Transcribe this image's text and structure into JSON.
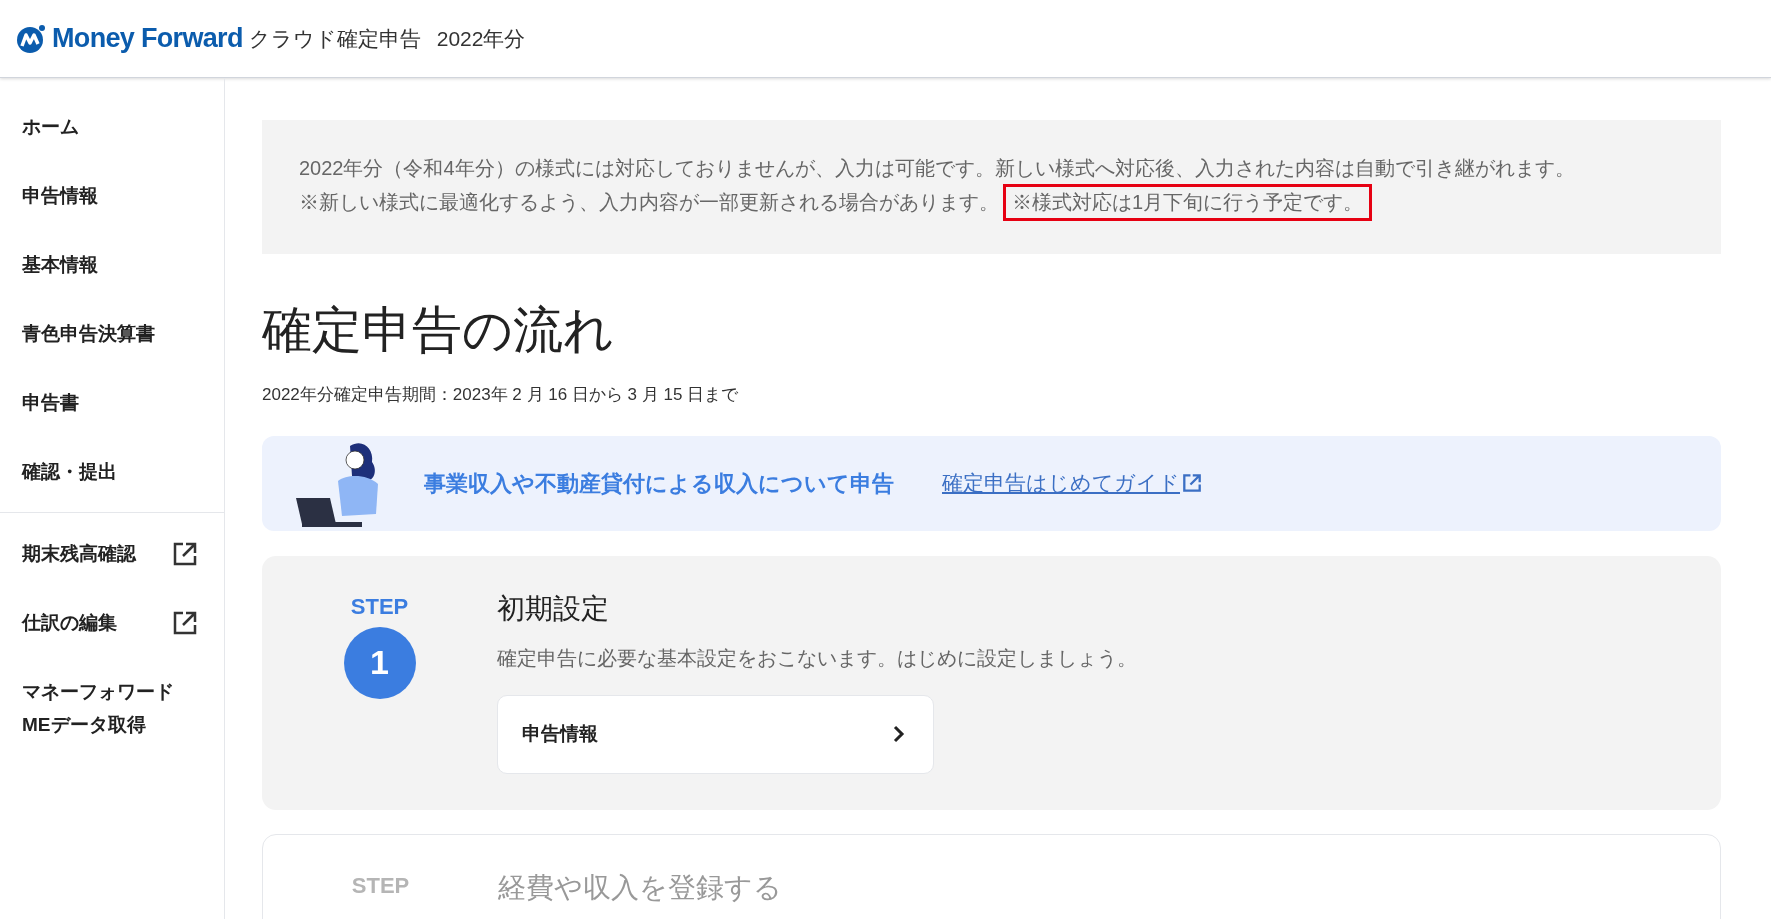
{
  "header": {
    "brand": "Money Forward",
    "product": "クラウド確定申告",
    "year": "2022年分"
  },
  "sidebar": {
    "items": [
      {
        "label": "ホーム",
        "external": false
      },
      {
        "label": "申告情報",
        "external": false
      },
      {
        "label": "基本情報",
        "external": false
      },
      {
        "label": "青色申告決算書",
        "external": false
      },
      {
        "label": "申告書",
        "external": false
      },
      {
        "label": "確認・提出",
        "external": false
      }
    ],
    "tools": [
      {
        "label": "期末残高確認",
        "external": true
      },
      {
        "label": "仕訳の編集",
        "external": true
      },
      {
        "label": "マネーフォワード\nMEデータ取得",
        "external": false
      }
    ]
  },
  "notice": {
    "line_1": "2022年分（令和4年分）の様式には対応しておりませんが、入力は可能です。新しい様式へ対応後、入力された内容は自動で引き継がれます。",
    "line_2": "※新しい様式に最適化するよう、入力内容が一部更新される場合があります。",
    "highlight": "※様式対応は1月下旬に行う予定です。"
  },
  "title": "確定申告の流れ",
  "period": "2022年分確定申告期間：2023年 2 月 16 日から 3 月 15 日まで",
  "banner": {
    "text": "事業収入や不動産貸付による収入について申告",
    "link": "確定申告はじめてガイド"
  },
  "steps": [
    {
      "step_label": "STEP",
      "number": "1",
      "title": "初期設定",
      "description": "確定申告に必要な基本設定をおこないます。はじめに設定しましょう。",
      "links": [
        "申告情報"
      ],
      "active": true
    },
    {
      "step_label": "STEP",
      "title": "経費や収入を登録する",
      "active": false
    }
  ]
}
